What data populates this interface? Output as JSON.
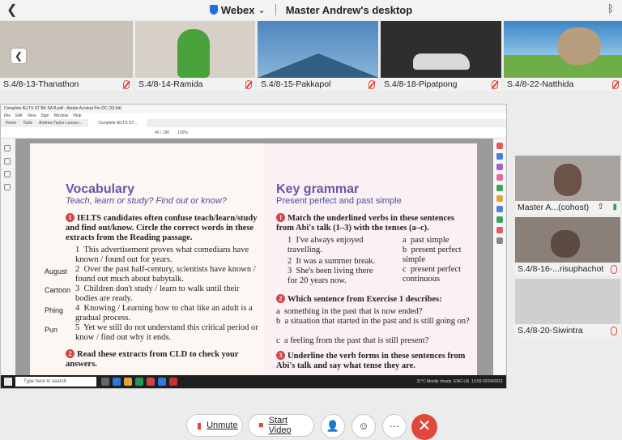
{
  "topbar": {
    "brand": "Webex",
    "brand_chevron": "⌄",
    "title": "Master Andrew's desktop"
  },
  "participants_strip": [
    {
      "name": "S.4/8-13-Thanathon",
      "bg": "#c9c2b9"
    },
    {
      "name": "S.4/8-14-Ramida",
      "bg": "#d7d0c6"
    },
    {
      "name": "S.4/8-15-Pakkapol",
      "bg": "#5c90bf"
    },
    {
      "name": "S.4/8-18-Pipatpong",
      "bg": "#3b3b3b"
    },
    {
      "name": "S.4/8-22-Natthida",
      "bg": "#4d93c9"
    }
  ],
  "acrobat": {
    "window_title": "Complete IELTS ST BK SA B.pdf - Adobe Acrobat Pro DC (32-bit)",
    "menu": [
      "File",
      "Edit",
      "View",
      "Sign",
      "Window",
      "Help"
    ],
    "tabs": [
      "Home",
      "Tools",
      "Andrew Taylor Lesson...",
      "Complete IELTS ST..."
    ],
    "page_info": "46 / 186",
    "zoom": "100%"
  },
  "vocabulary": {
    "heading": "Vocabulary",
    "subheading": "Teach, learn or study? Find out or know?",
    "q1_num": "1",
    "q1": "IELTS candidates often confuse teach/learn/study and find out/know. Circle the correct words in these extracts from the Reading passage.",
    "items": [
      {
        "n": "1",
        "text": "This advertisement proves what comedians have known / found out for years."
      },
      {
        "n": "2",
        "text": "Over the past half-century, scientists have known / found out much about babytalk."
      },
      {
        "n": "3",
        "text": "Children don't study / learn to walk until their bodies are ready."
      },
      {
        "n": "4",
        "text": "Knowing / Learning how to chat like an adult is a gradual process."
      },
      {
        "n": "5",
        "text": "Yet we still do not understand this critical period or know / find out why it ends."
      }
    ],
    "q2_num": "2",
    "q2": "Read these extracts from CLD to check your answers."
  },
  "handwritten": [
    "August",
    "Cartoon",
    "Phing",
    "Pun"
  ],
  "grammar": {
    "heading": "Key grammar",
    "subheading": "Present perfect and past simple",
    "q1_num": "1",
    "q1": "Match the underlined verbs in these sentences from Abi's talk (1–3) with the tenses (a–c).",
    "left": [
      {
        "n": "1",
        "text": "I've always enjoyed travelling."
      },
      {
        "n": "2",
        "text": "It was a summer break."
      },
      {
        "n": "3",
        "text": "She's been living there for 20 years now."
      }
    ],
    "right": [
      {
        "n": "a",
        "text": "past simple"
      },
      {
        "n": "b",
        "text": "present perfect simple"
      },
      {
        "n": "c",
        "text": "present perfect continuous"
      }
    ],
    "q2_num": "2",
    "q2": "Which sentence from Exercise 1 describes:",
    "q2_items": [
      {
        "n": "a",
        "text": "something in the past that is now ended?"
      },
      {
        "n": "b",
        "text": "a situation that started in the past and is still going on?"
      },
      {
        "n": "c",
        "text": "a feeling from the past that is still present?"
      }
    ],
    "q3_num": "3",
    "q3": "Underline the verb forms in these sentences from Abi's talk and say what tense they are."
  },
  "taskbar": {
    "search": "Type here to search",
    "weather": "31°C  Mostly cloudy",
    "lang": "ENG US",
    "time": "13:59",
    "date": "02/09/2021"
  },
  "side_panes": [
    {
      "name": "Master A...(cohost)",
      "bg": "#a9a3a0"
    },
    {
      "name": "S.4/8-16-...risuphachot",
      "bg": "#8a7f79"
    },
    {
      "name": "S.4/8-20-Siwintra",
      "bg": "#cfcfcf"
    }
  ],
  "controls": {
    "unmute": "Unmute",
    "start_video": "Start Video",
    "participants_icon": "👤",
    "reactions_icon": "☺",
    "more_icon": "···",
    "end_icon": "✕"
  }
}
